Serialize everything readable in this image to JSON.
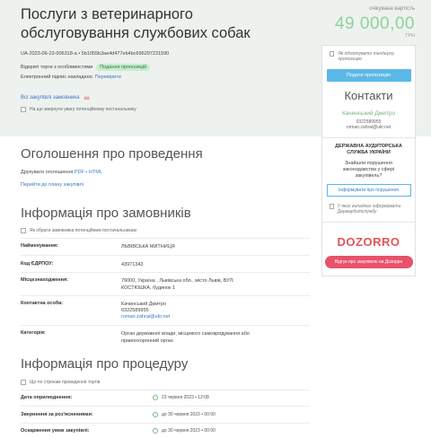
{
  "header": {
    "title": "Послуги з ветеринарного обслуговування службових собак",
    "expected_label": "очікувана вартість",
    "amount": "49 000,00",
    "currency": "ГРН",
    "tender_id": "UA-2023-06-23-006318-a • 5b1055b3ae4d477eb4bc696297231590",
    "status_prefix": "Відкриті торги з особливостями",
    "status_badge": "Подання пропозицій",
    "signature_text": "Електронний підпис накладено.",
    "signature_link": "Перевірити",
    "all_purchases": "Всі закупівлі замовника",
    "notice_text": "На що звернути увагу потенційному постачальнику"
  },
  "sidebar": {
    "prepare_check": "Як підготувати тендерну пропозицію",
    "submit_button": "Подати пропозицію",
    "contacts_title": "Контакти",
    "contact_name": "Качинський Дмитро",
    "contact_phone": "0322589955",
    "contact_email": "roman.zahrai@ukr.net",
    "audit_title": "ДЕРЖАВНА АУДИТОРСЬКА СЛУЖБА УКРАЇНИ",
    "audit_question": "Знайшли порушення законодавства у сфері закупівель?",
    "report_button": "Інформувати про порушення",
    "audit_check": "У яких випадках інформувати Держаудитслужбу",
    "dozorro_logo": "DOZORRO",
    "review_button": "Відгук про закупівлю на Дозорро"
  },
  "announcement": {
    "title": "Оголошення про проведення",
    "print_prefix": "Друкувати оголошення",
    "pdf": "PDF",
    "html": "HTML",
    "plan_link": "Перейти до плану закупівлі"
  },
  "customer": {
    "title": "Інформація про замовників",
    "check_note": "Як обрати замовника потенційним постачальникам",
    "rows": [
      {
        "label": "Найменування:",
        "value": "ЛЬВІВСЬКА МИТНИЦЯ"
      },
      {
        "label": "Код ЄДРПОУ:",
        "value": "43971343"
      },
      {
        "label": "Місцезнаходження:",
        "value": "79000, Україна , Львівська обл., місто Львів, ВУЛ. КОСТЮШКА, будинок 1"
      },
      {
        "label": "Контактна особа:",
        "value": "Качинський Дмитро",
        "value2": "0322589955",
        "value3": "roman.zahrai@ukr.net"
      },
      {
        "label": "Категорія:",
        "value": "Орган державної влади, місцевого самоврядування або правоохоронний орган"
      }
    ]
  },
  "procedure": {
    "title": "Інформація про процедуру",
    "check_note": "Що по строкам проведення торгів",
    "rows": [
      {
        "label": "Дата оприлюднення:",
        "value": "23 червня 2023 • 12:08"
      },
      {
        "label": "Звернення за роз'ясненнями:",
        "value": "до 30 червня 2023 • 00:00"
      },
      {
        "label": "Оскарження умов закупівлі:",
        "value": "до 30 червня 2023 • 00:00"
      }
    ]
  },
  "colors": {
    "amount": "#8fd19e",
    "badge_bg": "#c9ecd1",
    "primary_button": "#5cb8e8",
    "dozorro": "#e25555",
    "link": "#3a77c3"
  }
}
